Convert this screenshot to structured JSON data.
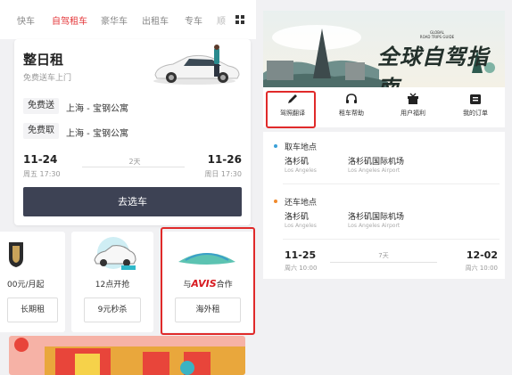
{
  "tabs": [
    {
      "label": "快车",
      "active": false
    },
    {
      "label": "自驾租车",
      "active": true
    },
    {
      "label": "豪华车",
      "active": false
    },
    {
      "label": "出租车",
      "active": false
    },
    {
      "label": "专车",
      "active": false
    },
    {
      "label": "顺",
      "active": false
    }
  ],
  "rent": {
    "title": "整日租",
    "subtitle": "免费送车上门",
    "deliver_tag": "免费送",
    "deliver_location": "上海 - 宝钢公寓",
    "pickup_tag": "免费取",
    "pickup_location": "上海 - 宝钢公寓",
    "start_date": "11-24",
    "start_time": "周五 17:30",
    "duration": "2天",
    "end_date": "11-26",
    "end_time": "周日 17:30",
    "button": "去选车"
  },
  "promos": [
    {
      "title": "00元/月起",
      "button": "长期租"
    },
    {
      "title": "12点开抢",
      "button": "9元秒杀"
    },
    {
      "title_pre": "与",
      "brand": "AVIS",
      "title_post": "合作",
      "button": "海外租"
    }
  ],
  "hero": {
    "title": "全球自驾指南",
    "small_lines": [
      "GLOBAL",
      "ROAD TRIPS GUIDE"
    ]
  },
  "quicknav": [
    {
      "label": "驾照翻译",
      "icon": "pen-icon"
    },
    {
      "label": "租车帮助",
      "icon": "headset-icon"
    },
    {
      "label": "用户福利",
      "icon": "gift-icon"
    },
    {
      "label": "我的订单",
      "icon": "orders-icon"
    }
  ],
  "trip": {
    "pickup_label": "取车地点",
    "pickup_city": "洛杉矶",
    "pickup_city_en": "Los Angeles",
    "pickup_place": "洛杉矶国际机场",
    "pickup_place_en": "Los Angeles Airport",
    "return_label": "还车地点",
    "return_city": "洛杉矶",
    "return_city_en": "Los Angeles",
    "return_place": "洛杉矶国际机场",
    "return_place_en": "Los Angeles Airport",
    "start_date": "11-25",
    "start_time": "周六 10:00",
    "duration": "7天",
    "end_date": "12-02",
    "end_time": "周六 10:00"
  },
  "colors": {
    "accent": "#e4393c",
    "button_dark": "#3d4254",
    "highlight_box": "#e02a2a",
    "pickup_dot": "#3aa0d8",
    "return_dot": "#f08a2c"
  }
}
